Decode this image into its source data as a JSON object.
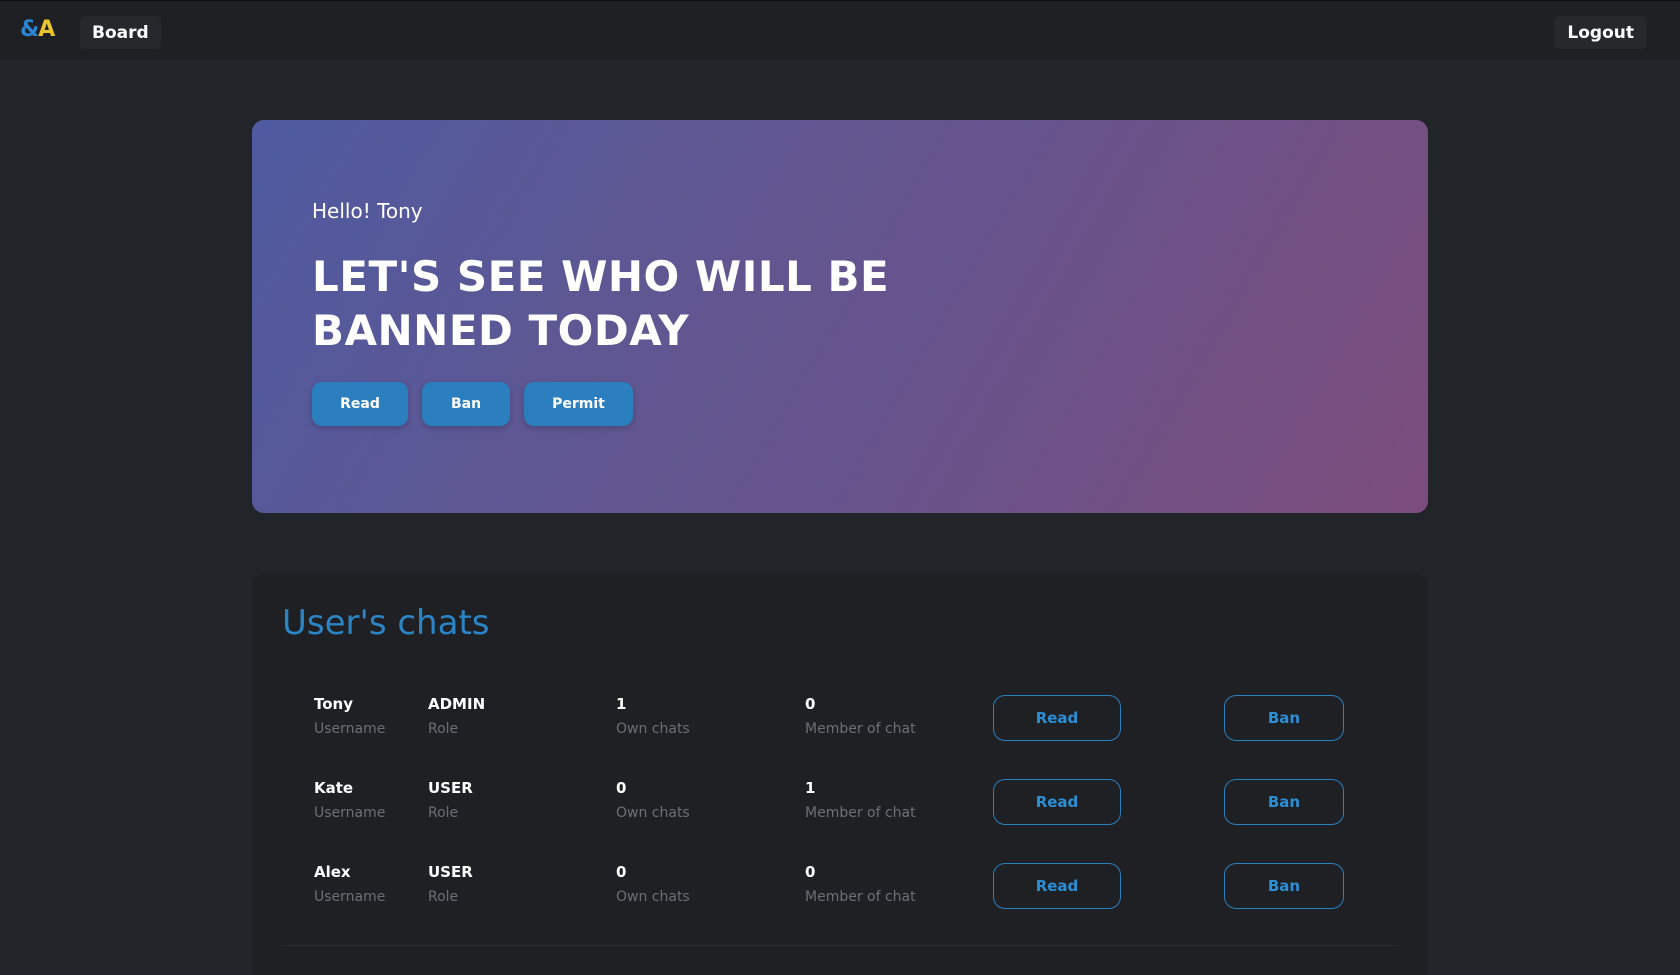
{
  "nav": {
    "logo_amp": "&",
    "logo_a": "A",
    "board_label": "Board",
    "logout_label": "Logout"
  },
  "hero": {
    "greeting": "Hello! Tony",
    "title": "LET'S SEE WHO WILL BE BANNED TODAY",
    "buttons": [
      "Read",
      "Ban",
      "Permit"
    ]
  },
  "chats": {
    "title": "User's chats",
    "labels": {
      "username": "Username",
      "role": "Role",
      "own_chats": "Own chats",
      "member_of_chat": "Member of chat"
    },
    "read_label": "Read",
    "ban_label": "Ban",
    "rows": [
      {
        "username": "Tony",
        "role": "ADMIN",
        "own_chats": "1",
        "member_of_chat": "0"
      },
      {
        "username": "Kate",
        "role": "USER",
        "own_chats": "0",
        "member_of_chat": "1"
      },
      {
        "username": "Alex",
        "role": "USER",
        "own_chats": "0",
        "member_of_chat": "0"
      }
    ]
  },
  "colors": {
    "background": "#212428",
    "accent": "#2b7fbe",
    "logo_amp": "#2b84d4",
    "logo_a": "#e9c42a"
  }
}
